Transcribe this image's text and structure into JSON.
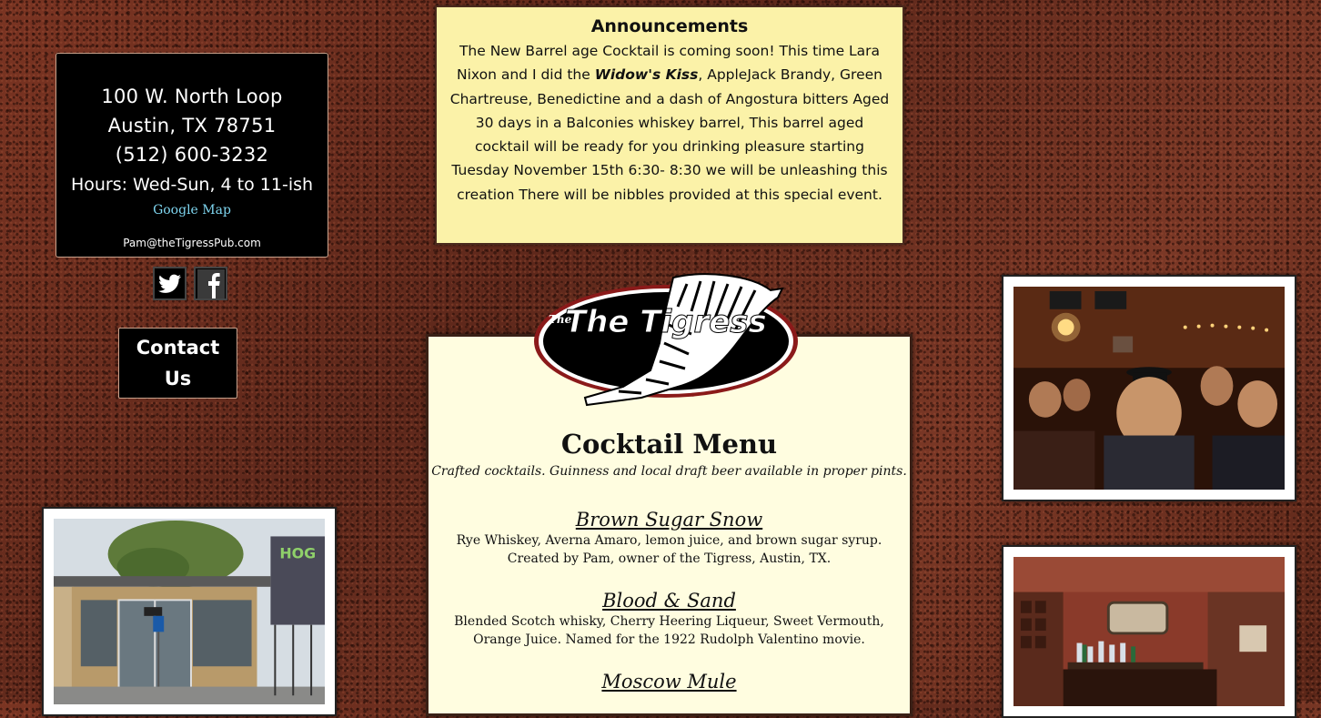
{
  "address": {
    "street": "100 W. North Loop",
    "city": "Austin, TX 78751",
    "phone": "(512) 600-3232",
    "hours": "Hours: Wed-Sun, 4 to 11-ish",
    "map_link": "Google Map",
    "email": "Pam@theTigressPub.com"
  },
  "social": {
    "twitter_icon": "twitter-icon",
    "facebook_icon": "facebook-icon"
  },
  "contact": {
    "line1": "Contact",
    "line2": "Us"
  },
  "announcement": {
    "title": "Announcements",
    "text_before": "The New Barrel age Cocktail is coming soon! This time Lara Nixon and I did the ",
    "text_bold": "Widow's Kiss",
    "text_after": ", AppleJack Brandy, Green Chartreuse,  Benedictine and a dash of Angostura bitters Aged 30 days in a Balconies whiskey barrel,  This barrel aged cocktail will be ready for you drinking pleasure  starting Tuesday November 15th 6:30- 8:30 we will be unleashing this creation There will be nibbles provided at this special event."
  },
  "logo": {
    "text": "The Tigress"
  },
  "menu": {
    "title": "Cocktail Menu",
    "subtitle": "Crafted cocktails. Guinness and local draft beer available in proper pints.",
    "drinks": [
      {
        "name": "Brown Sugar Snow",
        "desc1": "Rye Whiskey, Averna Amaro, lemon juice, and brown sugar syrup.",
        "desc2": "Created by Pam, owner of the Tigress, Austin, TX."
      },
      {
        "name": "Blood & Sand",
        "desc1": "Blended Scotch whisky, Cherry Heering Liqueur, Sweet Vermouth,",
        "desc2": "Orange Juice. Named for the 1922 Rudolph Valentino movie."
      },
      {
        "name": "Moscow Mule",
        "desc1": "",
        "desc2": ""
      }
    ]
  },
  "colors": {
    "background": "#6e2f1f",
    "announcement_bg": "#fbf2a8",
    "menu_bg": "#fffde0",
    "link": "#7fd6f0"
  }
}
